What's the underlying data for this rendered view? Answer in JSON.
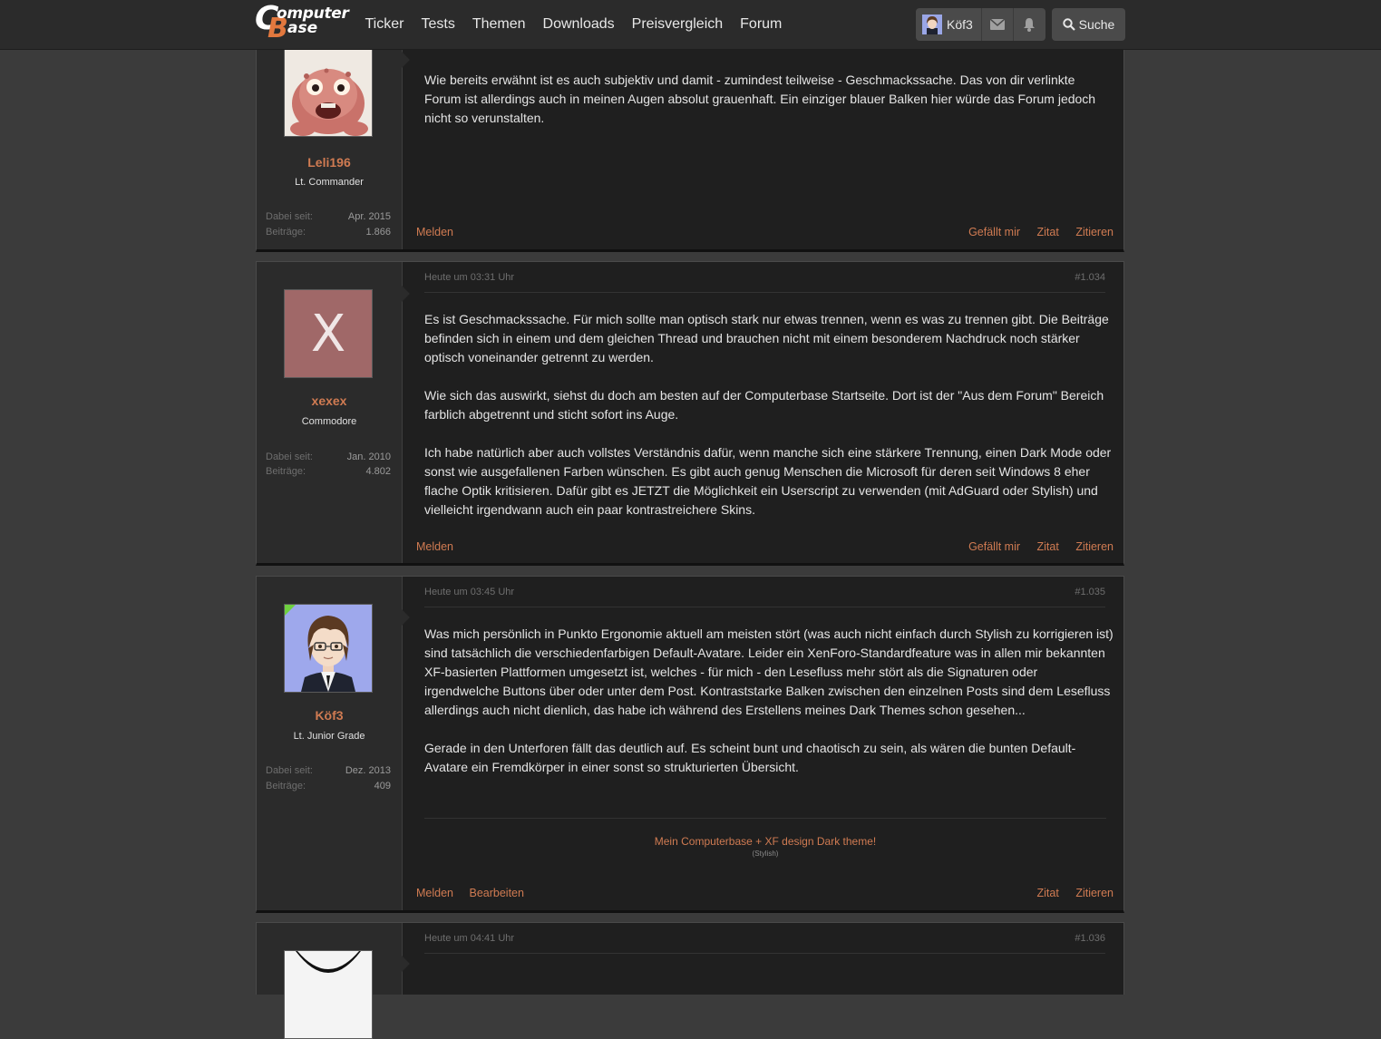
{
  "header": {
    "logo_line1": "omputer",
    "logo_line2": "ase",
    "logo_c": "C",
    "logo_b": "B",
    "nav": [
      "Ticker",
      "Tests",
      "Themen",
      "Downloads",
      "Preisvergleich",
      "Forum"
    ],
    "user_name": "Köf3",
    "search_label": "Suche",
    "brand_color": "#e2783e"
  },
  "posts": [
    {
      "author": "Leli196",
      "rank": "Lt. Commander",
      "stats": [
        {
          "label": "Dabei seit:",
          "value": "Apr. 2015"
        },
        {
          "label": "Beiträge:",
          "value": "1.866"
        }
      ],
      "paragraphs": [
        "Wie bereits erwähnt ist es auch subjektiv und damit - zumindest teilweise - Geschmackssache. Das von dir verlinkte Forum ist allerdings auch in meinen Augen absolut grauenhaft. Ein einziger blauer Balken hier würde das Forum jedoch nicht so verunstalten."
      ],
      "actions_left": [
        "Melden"
      ],
      "actions_right": [
        "Gefällt mir",
        "Zitat",
        "Zitieren"
      ]
    },
    {
      "timestamp": "Heute um 03:31 Uhr",
      "number": "#1.034",
      "author": "xexex",
      "avatar_letter": "X",
      "avatar_color": "#a06868",
      "rank": "Commodore",
      "stats": [
        {
          "label": "Dabei seit:",
          "value": "Jan. 2010"
        },
        {
          "label": "Beiträge:",
          "value": "4.802"
        }
      ],
      "paragraphs": [
        "Es ist Geschmackssache. Für mich sollte man optisch stark nur etwas trennen, wenn es was zu trennen gibt. Die Beiträge befinden sich in einem und dem gleichen Thread und brauchen nicht mit einem besonderem Nachdruck noch stärker optisch voneinander getrennt zu werden.",
        "Wie sich das auswirkt, siehst du doch am besten auf der Computerbase Startseite. Dort ist der \"Aus dem Forum\" Bereich farblich abgetrennt und sticht sofort ins Auge.",
        "Ich habe natürlich aber auch vollstes Verständnis dafür, wenn manche sich eine stärkere Trennung, einen Dark Mode oder sonst wie ausgefallenen Farben wünschen. Es gibt auch genug Menschen die Microsoft für deren seit Windows 8 eher flache Optik kritisieren. Dafür gibt es JETZT die Möglichkeit ein Userscript zu verwenden (mit AdGuard oder Stylish) und vielleicht irgendwann auch ein paar kontrastreichere Skins."
      ],
      "actions_left": [
        "Melden"
      ],
      "actions_right": [
        "Gefällt mir",
        "Zitat",
        "Zitieren"
      ]
    },
    {
      "timestamp": "Heute um 03:45 Uhr",
      "number": "#1.035",
      "author": "Köf3",
      "rank": "Lt. Junior Grade",
      "stats": [
        {
          "label": "Dabei seit:",
          "value": "Dez. 2013"
        },
        {
          "label": "Beiträge:",
          "value": "409"
        }
      ],
      "paragraphs": [
        "Was mich persönlich in Punkto Ergonomie aktuell am meisten stört (was auch nicht einfach durch Stylish zu korrigieren ist) sind tatsächlich die verschiedenfarbigen Default-Avatare. Leider ein XenForo-Standardfeature was in allen mir bekannten XF-basierten Plattformen umgesetzt ist, welches - für mich - den Lesefluss mehr stört als die Signaturen oder irgendwelche Buttons über oder unter dem Post. Kontraststarke Balken zwischen den einzelnen Posts sind dem Lesefluss allerdings auch nicht dienlich, das habe ich während des Erstellens meines Dark Themes schon gesehen...",
        "Gerade in den Unterforen fällt das deutlich auf. Es scheint bunt und chaotisch zu sein, als wären die bunten Default-Avatare ein Fremdkörper in einer sonst so strukturierten Übersicht."
      ],
      "signature_link": "Mein Computerbase + XF design Dark theme!",
      "signature_note": "(Stylish)",
      "actions_left": [
        "Melden",
        "Bearbeiten"
      ],
      "actions_right": [
        "Zitat",
        "Zitieren"
      ]
    },
    {
      "timestamp": "Heute um 04:41 Uhr",
      "number": "#1.036"
    }
  ]
}
